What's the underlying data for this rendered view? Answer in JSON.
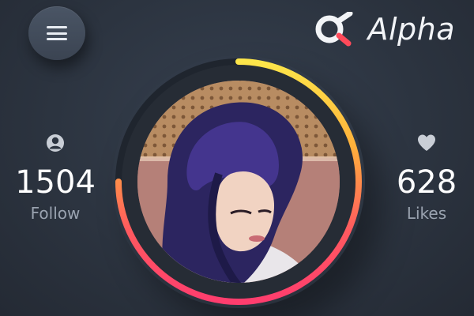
{
  "header": {
    "menu_icon": "hamburger-icon",
    "logo_icon": "alpha-symbol-icon",
    "brand_name": "Alpha"
  },
  "stats": {
    "follow": {
      "icon": "user-icon",
      "value": "1504",
      "label": "Follow"
    },
    "likes": {
      "icon": "heart-icon",
      "value": "628",
      "label": "Likes"
    }
  },
  "profile": {
    "progress": 0.75,
    "progress_colors": [
      "#fde64a",
      "#ffb13b",
      "#ff5a5f",
      "#ff3d6e"
    ],
    "ring_track_color": "#1f252e"
  }
}
